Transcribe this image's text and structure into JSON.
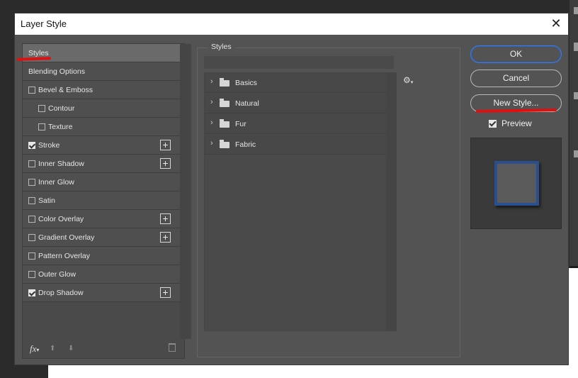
{
  "dialog": {
    "title": "Layer Style",
    "close_icon": "close-icon"
  },
  "left": {
    "items": [
      {
        "label": "Styles",
        "has_checkbox": false,
        "checked": false,
        "has_plus": false,
        "selected": true,
        "indent": 0
      },
      {
        "label": "Blending Options",
        "has_checkbox": false,
        "checked": false,
        "has_plus": false,
        "selected": false,
        "indent": 0
      },
      {
        "label": "Bevel & Emboss",
        "has_checkbox": true,
        "checked": false,
        "has_plus": false,
        "selected": false,
        "indent": 0
      },
      {
        "label": "Contour",
        "has_checkbox": true,
        "checked": false,
        "has_plus": false,
        "selected": false,
        "indent": 1
      },
      {
        "label": "Texture",
        "has_checkbox": true,
        "checked": false,
        "has_plus": false,
        "selected": false,
        "indent": 1
      },
      {
        "label": "Stroke",
        "has_checkbox": true,
        "checked": true,
        "has_plus": true,
        "selected": false,
        "indent": 0
      },
      {
        "label": "Inner Shadow",
        "has_checkbox": true,
        "checked": false,
        "has_plus": true,
        "selected": false,
        "indent": 0
      },
      {
        "label": "Inner Glow",
        "has_checkbox": true,
        "checked": false,
        "has_plus": false,
        "selected": false,
        "indent": 0
      },
      {
        "label": "Satin",
        "has_checkbox": true,
        "checked": false,
        "has_plus": false,
        "selected": false,
        "indent": 0
      },
      {
        "label": "Color Overlay",
        "has_checkbox": true,
        "checked": false,
        "has_plus": true,
        "selected": false,
        "indent": 0
      },
      {
        "label": "Gradient Overlay",
        "has_checkbox": true,
        "checked": false,
        "has_plus": true,
        "selected": false,
        "indent": 0
      },
      {
        "label": "Pattern Overlay",
        "has_checkbox": true,
        "checked": false,
        "has_plus": false,
        "selected": false,
        "indent": 0
      },
      {
        "label": "Outer Glow",
        "has_checkbox": true,
        "checked": false,
        "has_plus": false,
        "selected": false,
        "indent": 0
      },
      {
        "label": "Drop Shadow",
        "has_checkbox": true,
        "checked": true,
        "has_plus": true,
        "selected": false,
        "indent": 0
      }
    ],
    "footer": {
      "fx_label": "fx",
      "move_up_icon": "arrow-up-icon",
      "move_down_icon": "arrow-down-icon",
      "delete_icon": "trash-icon"
    }
  },
  "middle": {
    "panel_title": "Styles",
    "groups": [
      {
        "label": "Basics"
      },
      {
        "label": "Natural"
      },
      {
        "label": "Fur"
      },
      {
        "label": "Fabric"
      }
    ],
    "settings_icon": "gear-icon"
  },
  "right": {
    "ok_label": "OK",
    "cancel_label": "Cancel",
    "new_style_label": "New Style...",
    "preview_label": "Preview",
    "preview_checked": true
  },
  "colors": {
    "accent": "#3f7be0",
    "stroke_preview": "#2a4e8e",
    "annotation": "#e01010"
  }
}
